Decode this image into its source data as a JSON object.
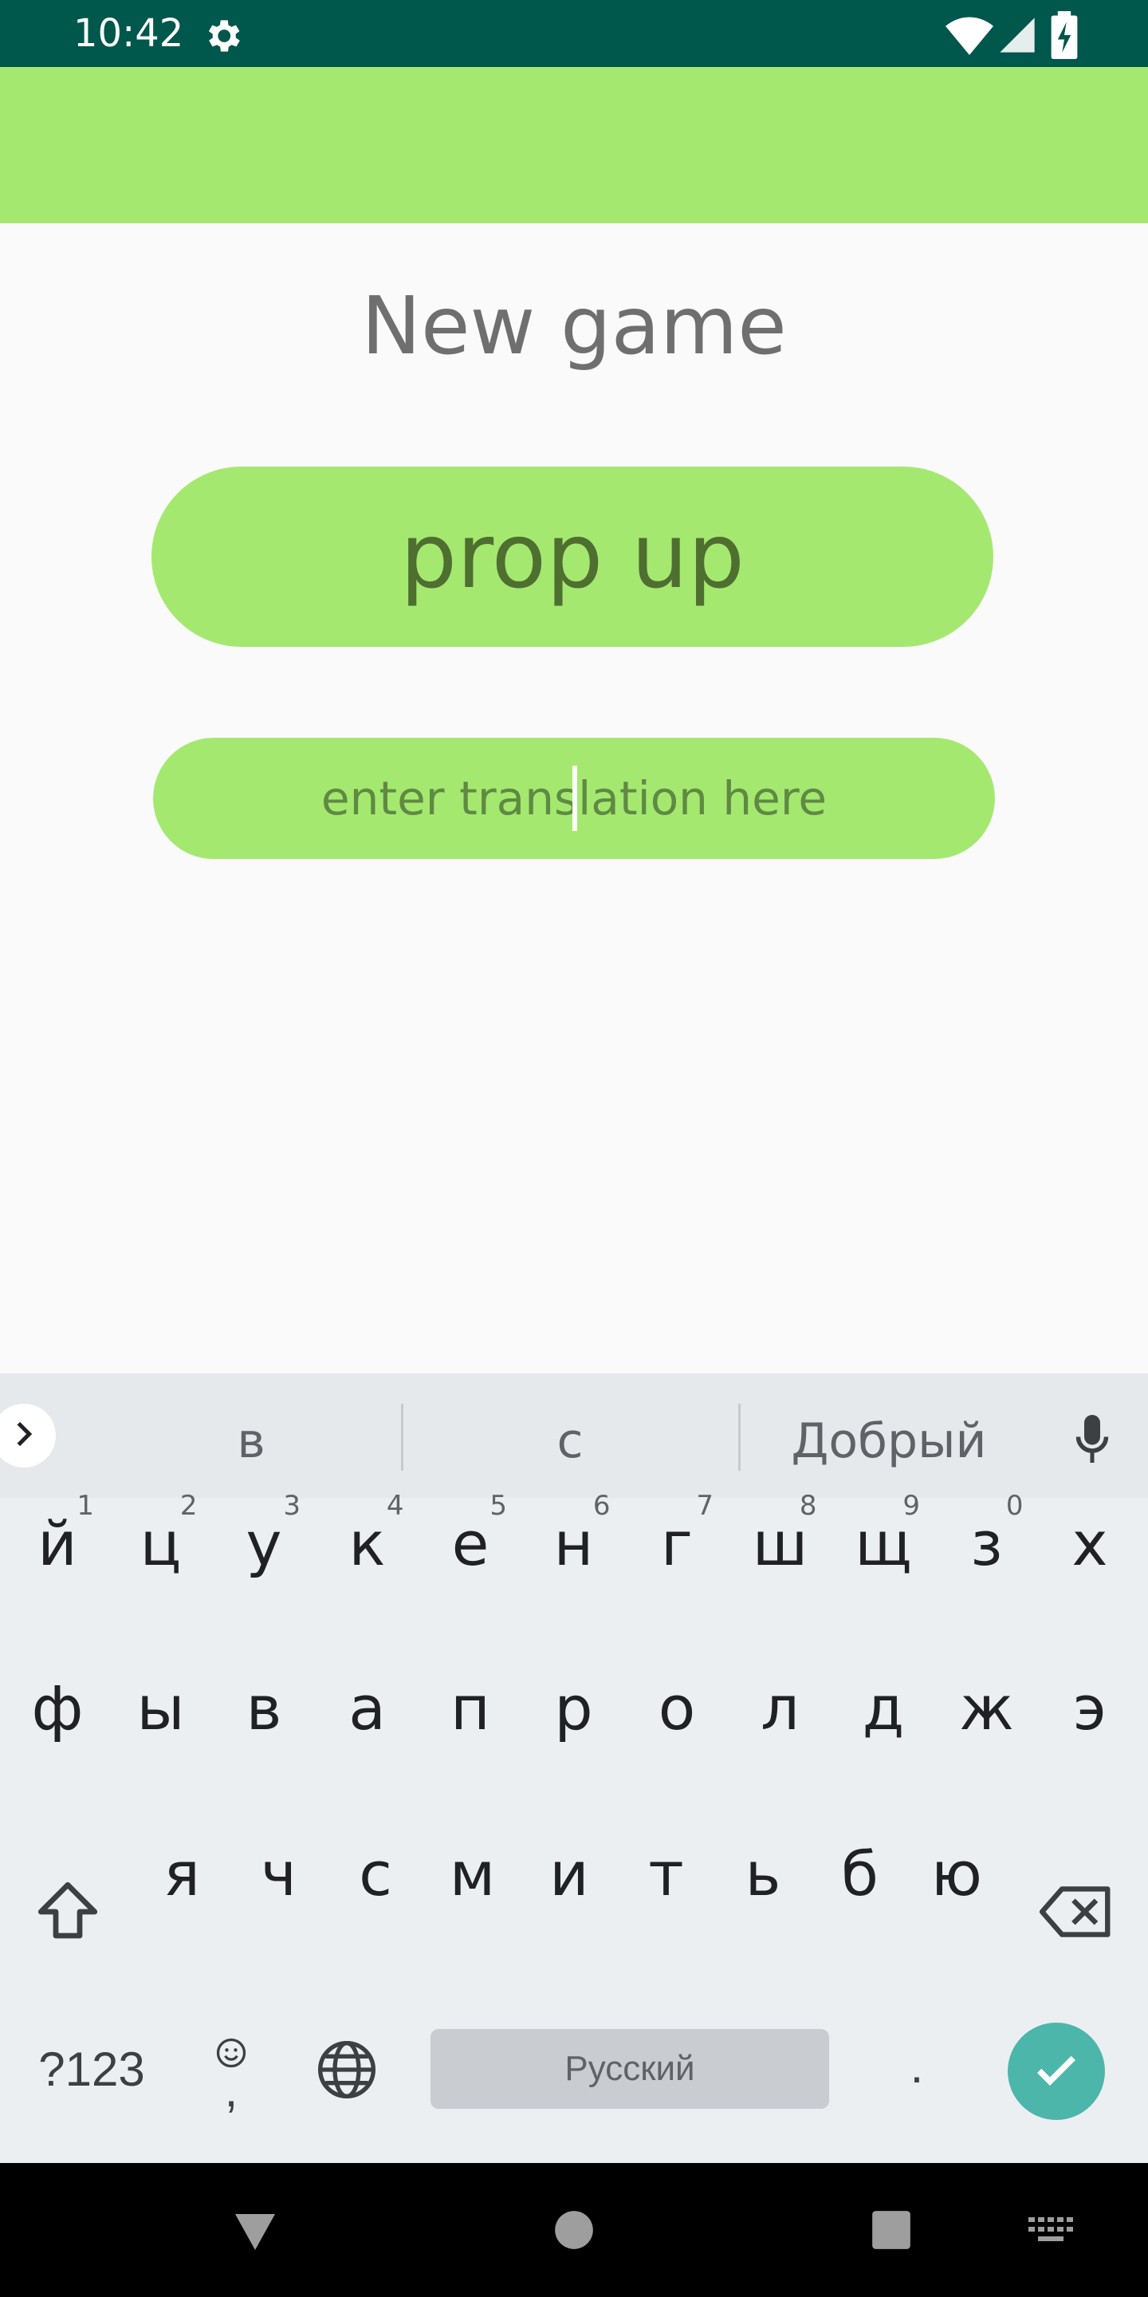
{
  "status": {
    "time": "10:42",
    "icons": [
      "gear-icon",
      "wifi-icon",
      "signal-icon",
      "battery-charging-icon"
    ]
  },
  "screen": {
    "title": "New game",
    "word": "prop up",
    "answer_placeholder": "enter translation here"
  },
  "keyboard": {
    "suggestions": [
      "в",
      "с",
      "Добрый"
    ],
    "rows": [
      [
        {
          "k": "й",
          "h": "1"
        },
        {
          "k": "ц",
          "h": "2"
        },
        {
          "k": "у",
          "h": "3"
        },
        {
          "k": "к",
          "h": "4"
        },
        {
          "k": "е",
          "h": "5"
        },
        {
          "k": "н",
          "h": "6"
        },
        {
          "k": "г",
          "h": "7"
        },
        {
          "k": "ш",
          "h": "8"
        },
        {
          "k": "щ",
          "h": "9"
        },
        {
          "k": "з",
          "h": "0"
        },
        {
          "k": "х",
          "h": ""
        }
      ],
      [
        {
          "k": "ф"
        },
        {
          "k": "ы"
        },
        {
          "k": "в"
        },
        {
          "k": "а"
        },
        {
          "k": "п"
        },
        {
          "k": "р"
        },
        {
          "k": "о"
        },
        {
          "k": "л"
        },
        {
          "k": "д"
        },
        {
          "k": "ж"
        },
        {
          "k": "э"
        }
      ],
      [
        {
          "k": "я"
        },
        {
          "k": "ч"
        },
        {
          "k": "с"
        },
        {
          "k": "м"
        },
        {
          "k": "и"
        },
        {
          "k": "т"
        },
        {
          "k": "ь"
        },
        {
          "k": "б"
        },
        {
          "k": "ю"
        }
      ]
    ],
    "symbols_label": "?123",
    "comma_label": ",",
    "space_label": "Русский",
    "period_label": ".",
    "accent": "#4cb6ab"
  },
  "colors": {
    "status_bar": "#00574b",
    "app_bar": "#a5e870",
    "card": "#a5e870"
  }
}
